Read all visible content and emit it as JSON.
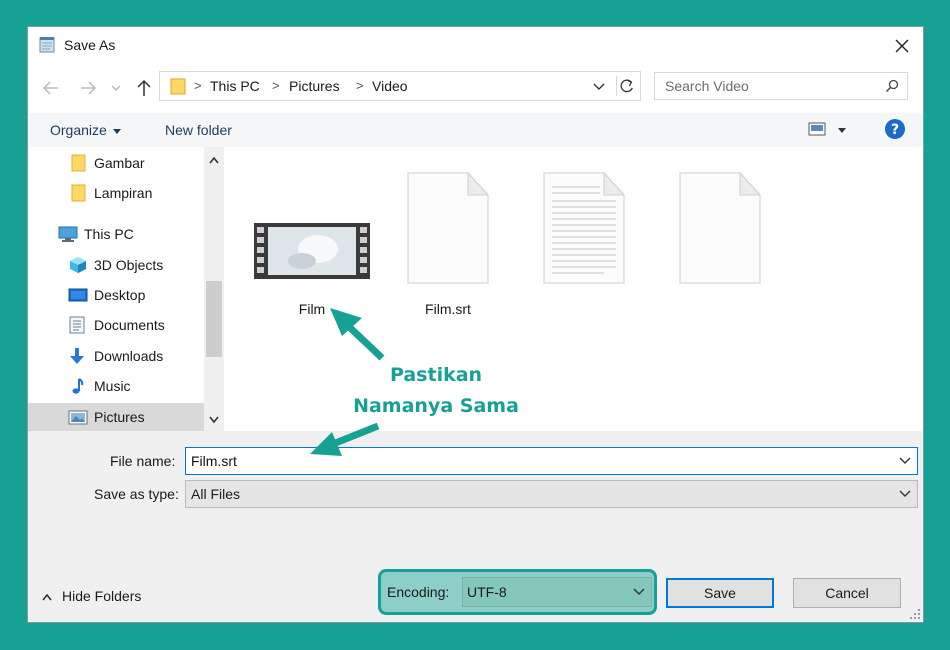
{
  "window": {
    "title": "Save As",
    "title_icon": "notepad-icon",
    "close_icon": "close-icon"
  },
  "address": {
    "segments": [
      "This PC",
      "Pictures",
      "Video"
    ],
    "folder_icon": "folder-icon"
  },
  "search": {
    "placeholder": "Search Video",
    "icon": "search-icon"
  },
  "toolbar": {
    "organize_label": "Organize",
    "new_folder_label": "New folder",
    "view_icon": "view-options-icon",
    "help_icon": "help-icon"
  },
  "sidebar": {
    "items": [
      {
        "label": "Gambar",
        "icon": "folder-icon"
      },
      {
        "label": "Lampiran",
        "icon": "folder-icon"
      },
      {
        "label": "This PC",
        "icon": "computer-icon"
      },
      {
        "label": "3D Objects",
        "icon": "3d-objects-icon"
      },
      {
        "label": "Desktop",
        "icon": "desktop-icon"
      },
      {
        "label": "Documents",
        "icon": "documents-icon"
      },
      {
        "label": "Downloads",
        "icon": "downloads-icon"
      },
      {
        "label": "Music",
        "icon": "music-icon"
      },
      {
        "label": "Pictures",
        "icon": "pictures-icon"
      }
    ],
    "selected": "Pictures"
  },
  "files": [
    {
      "label": "Film",
      "icon": "video-file-icon"
    },
    {
      "label": "Film.srt",
      "icon": "blank-file-icon"
    },
    {
      "label": "",
      "icon": "text-file-icon"
    },
    {
      "label": "",
      "icon": "blank-file-icon"
    }
  ],
  "form": {
    "file_name_label": "File name:",
    "file_name_value": "Film.srt",
    "save_type_label": "Save as type:",
    "save_type_value": "All Files",
    "hide_folders_label": "Hide Folders",
    "encoding_label": "Encoding:",
    "encoding_value": "UTF-8",
    "save_label": "Save",
    "cancel_label": "Cancel"
  },
  "annotation": {
    "line1": "Pastikan",
    "line2": "Namanya Sama",
    "color": "#17a194"
  }
}
